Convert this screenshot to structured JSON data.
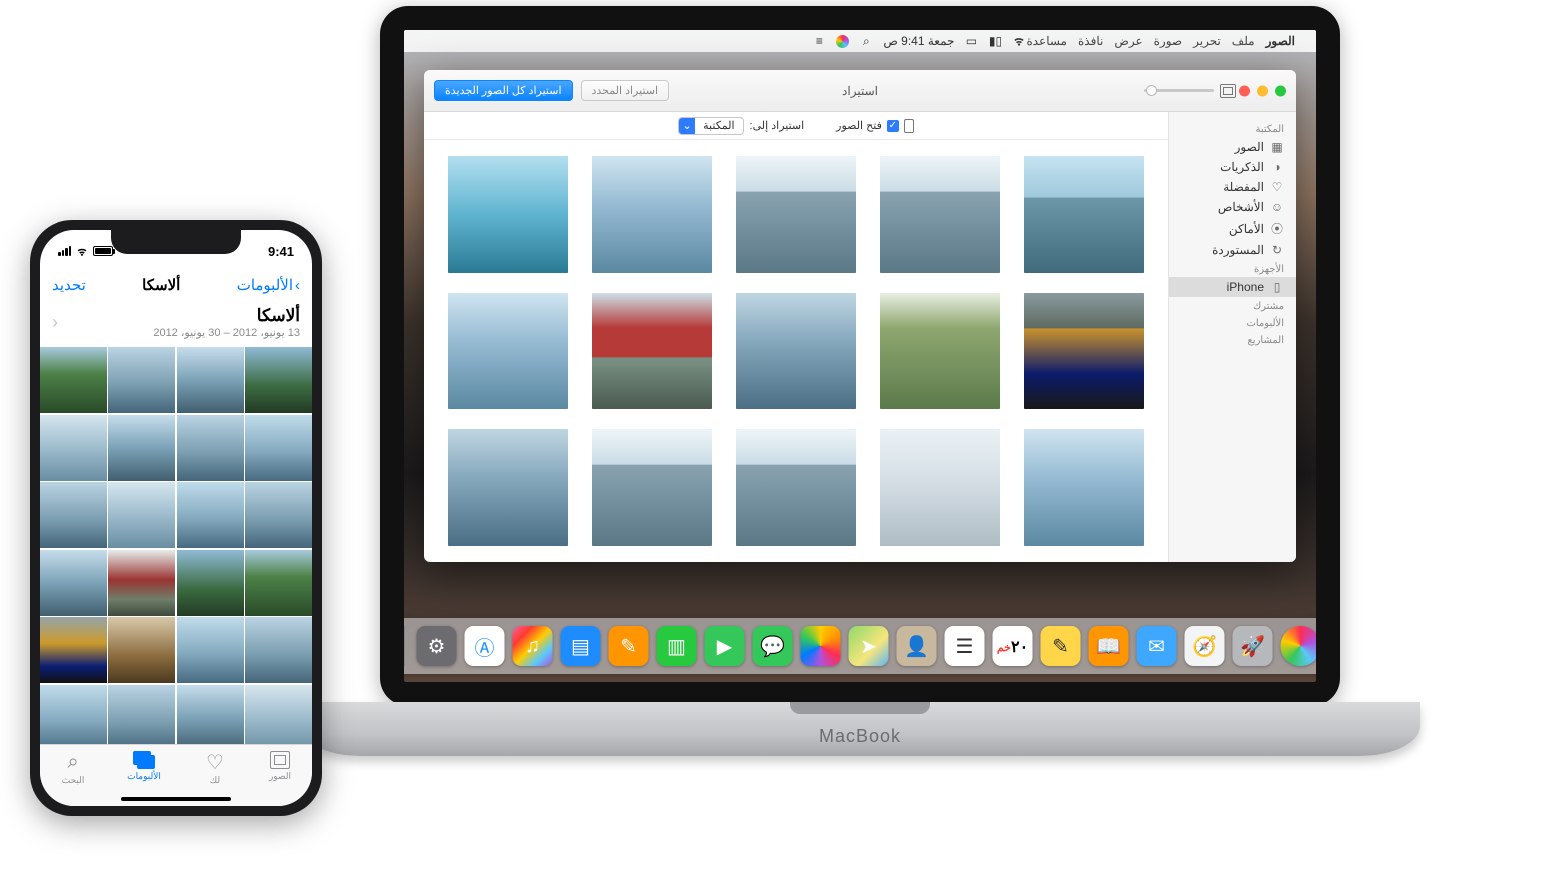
{
  "macos": {
    "menubar": {
      "app": "الصور",
      "menus": [
        "ملف",
        "تحرير",
        "صورة",
        "عرض",
        "نافذة",
        "مساعدة"
      ],
      "time": "جمعة 9:41 ص"
    },
    "photos_window": {
      "title": "استيراد",
      "btn_import_selected": "استيراد المحدد",
      "btn_import_all": "استيراد كل الصور الجديدة",
      "import_to_label": "استيراد إلى:",
      "import_to_value": "المكتبة",
      "open_photos": "فتح الصور",
      "sidebar": {
        "library_header": "المكتبة",
        "library_items": [
          "الصور",
          "الذكريات",
          "المفضلة",
          "الأشخاص",
          "الأماكن",
          "المستوردة"
        ],
        "devices_header": "الأجهزة",
        "device": "iPhone",
        "shared": "مشترك",
        "albums": "الألبومات",
        "projects": "المشاريع"
      }
    },
    "dock": {
      "calendar_day": "٢٠",
      "calendar_weekday": "خم"
    },
    "label": "MacBook"
  },
  "ios": {
    "time": "9:41",
    "nav": {
      "back": "الألبومات",
      "title": "ألاسكا",
      "action": "تحديد"
    },
    "subheader": {
      "title": "ألاسكا",
      "date": "13 يونيو، 2012 – 30 يونيو، 2012"
    },
    "tabs": {
      "photos": "الصور",
      "foryou": "لك",
      "albums": "الألبومات",
      "search": "البحث"
    }
  }
}
